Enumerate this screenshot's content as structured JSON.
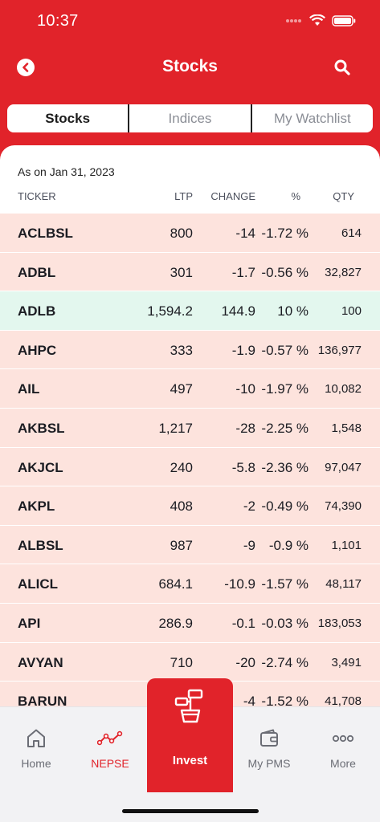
{
  "status": {
    "time": "10:37"
  },
  "nav": {
    "title": "Stocks"
  },
  "tabs": [
    "Stocks",
    "Indices",
    "My Watchlist"
  ],
  "as_on": "As on Jan 31, 2023",
  "columns": {
    "ticker": "TICKER",
    "ltp": "LTP",
    "change": "CHANGE",
    "pct": "%",
    "qty": "QTY"
  },
  "rows": [
    {
      "ticker": "ACLBSL",
      "ltp": "800",
      "change": "-14",
      "pct": "-1.72 %",
      "qty": "614",
      "trend": "down"
    },
    {
      "ticker": "ADBL",
      "ltp": "301",
      "change": "-1.7",
      "pct": "-0.56 %",
      "qty": "32,827",
      "trend": "down"
    },
    {
      "ticker": "ADLB",
      "ltp": "1,594.2",
      "change": "144.9",
      "pct": "10 %",
      "qty": "100",
      "trend": "up"
    },
    {
      "ticker": "AHPC",
      "ltp": "333",
      "change": "-1.9",
      "pct": "-0.57 %",
      "qty": "136,977",
      "trend": "down"
    },
    {
      "ticker": "AIL",
      "ltp": "497",
      "change": "-10",
      "pct": "-1.97 %",
      "qty": "10,082",
      "trend": "down"
    },
    {
      "ticker": "AKBSL",
      "ltp": "1,217",
      "change": "-28",
      "pct": "-2.25 %",
      "qty": "1,548",
      "trend": "down"
    },
    {
      "ticker": "AKJCL",
      "ltp": "240",
      "change": "-5.8",
      "pct": "-2.36 %",
      "qty": "97,047",
      "trend": "down"
    },
    {
      "ticker": "AKPL",
      "ltp": "408",
      "change": "-2",
      "pct": "-0.49 %",
      "qty": "74,390",
      "trend": "down"
    },
    {
      "ticker": "ALBSL",
      "ltp": "987",
      "change": "-9",
      "pct": "-0.9 %",
      "qty": "1,101",
      "trend": "down"
    },
    {
      "ticker": "ALICL",
      "ltp": "684.1",
      "change": "-10.9",
      "pct": "-1.57 %",
      "qty": "48,117",
      "trend": "down"
    },
    {
      "ticker": "API",
      "ltp": "286.9",
      "change": "-0.1",
      "pct": "-0.03 %",
      "qty": "183,053",
      "trend": "down"
    },
    {
      "ticker": "AVYAN",
      "ltp": "710",
      "change": "-20",
      "pct": "-2.74 %",
      "qty": "3,491",
      "trend": "down"
    },
    {
      "ticker": "BARUN",
      "ltp": "",
      "change": "-4",
      "pct": "-1.52 %",
      "qty": "41,708",
      "trend": "down"
    }
  ],
  "bottom_nav": {
    "home": "Home",
    "nepse": "NEPSE",
    "invest": "Invest",
    "pms": "My PMS",
    "more": "More"
  },
  "colors": {
    "brand": "#e1232a",
    "down_row": "#fde3dd",
    "up_row": "#e3f7ee"
  }
}
